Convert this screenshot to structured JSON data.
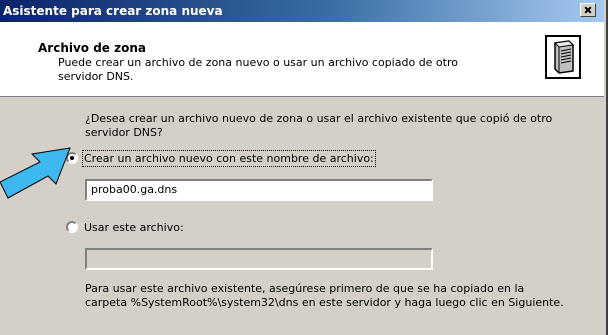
{
  "window": {
    "title": "Asistente para crear zona nueva",
    "close_label": "Cerrar"
  },
  "header": {
    "title": "Archivo de zona",
    "description": "Puede crear un archivo de zona nuevo o usar un archivo copiado de otro servidor DNS.",
    "icon": "server-icon"
  },
  "main": {
    "question": "¿Desea crear un archivo nuevo de zona o usar el archivo existente que copió de otro servidor DNS?",
    "option_new": {
      "label": "Crear un archivo nuevo con este nombre de archivo:",
      "checked": true
    },
    "filename_value": "proba00.ga.dns",
    "option_existing": {
      "label": "Usar este archivo:",
      "checked": false
    },
    "existing_file_value": "",
    "info": "Para usar este archivo existente, asegúrese primero de que se ha copiado en la carpeta %SystemRoot%\\system32\\dns en este servidor y haga luego clic en Siguiente."
  },
  "colors": {
    "titlebar_start": "#0a246a",
    "titlebar_end": "#a6caf0",
    "dialog_bg": "#d4d0c8",
    "arrow_fill": "#3fb8f0",
    "page_bg": "#ffffcc"
  }
}
